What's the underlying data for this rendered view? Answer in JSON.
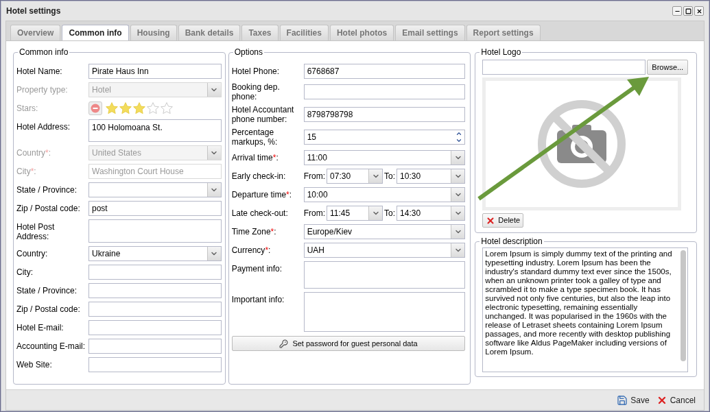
{
  "window": {
    "title": "Hotel settings"
  },
  "tabs": [
    {
      "label": "Overview",
      "selected": false
    },
    {
      "label": "Common info",
      "selected": true
    },
    {
      "label": "Housing",
      "selected": false
    },
    {
      "label": "Bank details",
      "selected": false
    },
    {
      "label": "Taxes",
      "selected": false
    },
    {
      "label": "Facilities",
      "selected": false
    },
    {
      "label": "Hotel photos",
      "selected": false
    },
    {
      "label": "Email settings",
      "selected": false
    },
    {
      "label": "Report settings",
      "selected": false
    }
  ],
  "common_info": {
    "legend": "Common info",
    "fields": [
      {
        "kind": "text",
        "label": "Hotel Name:",
        "value": "Pirate Haus Inn",
        "disabled": false
      },
      {
        "kind": "select",
        "label": "Property type:",
        "value": "Hotel",
        "disabled": true
      },
      {
        "kind": "stars",
        "label": "Stars:",
        "stars": 3,
        "disabled": true
      },
      {
        "kind": "textarea",
        "label": "Hotel Address:",
        "value": "100 Holomoana St.",
        "disabled": false
      },
      {
        "kind": "select",
        "label": "Country",
        "required_mark": "*",
        "label_end": ":",
        "value": "United States",
        "disabled": true
      },
      {
        "kind": "text",
        "label": "City",
        "required_mark": "*",
        "label_end": ":",
        "value": "Washington Court House",
        "disabled": true
      },
      {
        "kind": "select",
        "label": "State / Province:",
        "disabled": false
      },
      {
        "kind": "text",
        "label": "Zip / Postal code:",
        "value": "post",
        "disabled": false
      },
      {
        "kind": "textarea",
        "label": "Hotel Post Address:",
        "disabled": false
      },
      {
        "kind": "select",
        "label": "Country:",
        "value": "Ukraine",
        "disabled": false
      },
      {
        "kind": "text",
        "label": "City:",
        "disabled": false
      },
      {
        "kind": "text",
        "label": "State / Province:",
        "disabled": false
      },
      {
        "kind": "text",
        "label": "Zip / Postal code:",
        "disabled": false
      },
      {
        "kind": "text",
        "label": "Hotel E-mail:",
        "disabled": false
      },
      {
        "kind": "text",
        "label": "Accounting E-mail:",
        "disabled": false
      },
      {
        "kind": "text",
        "label": "Web Site:",
        "disabled": false
      }
    ]
  },
  "options": {
    "legend": "Options",
    "fields": [
      {
        "kind": "text",
        "label": "Hotel Phone:",
        "value": "6768687",
        "disabled": false
      },
      {
        "kind": "text",
        "label": "Booking dep. phone:",
        "disabled": false
      },
      {
        "kind": "text",
        "label": "Hotel Accountant phone number:",
        "value": "8798798798",
        "disabled": false
      },
      {
        "kind": "spinner",
        "label": "Percentage markups, %:",
        "value": "15",
        "disabled": false
      },
      {
        "kind": "select",
        "label": "Arrival time",
        "required_mark": "*",
        "label_end": ":",
        "value": "11:00",
        "disabled": false
      },
      {
        "kind": "range",
        "label": "Early check-in:",
        "from_label": "From:",
        "from": "07:30",
        "to_label": "To:",
        "to": "10:30",
        "disabled": false
      },
      {
        "kind": "select",
        "label": "Departure time",
        "required_mark": "*",
        "label_end": ":",
        "value": "10:00",
        "disabled": false
      },
      {
        "kind": "range",
        "label": "Late check-out:",
        "from_label": "From:",
        "from": "11:45",
        "to_label": "To:",
        "to": "14:30",
        "disabled": false
      },
      {
        "kind": "select",
        "label": "Time Zone",
        "required_mark": "*",
        "label_end": ":",
        "value": "Europe/Kiev",
        "disabled": false
      },
      {
        "kind": "select",
        "label": "Currency",
        "required_mark": "*",
        "label_end": ":",
        "value": "UAH",
        "disabled": false
      },
      {
        "kind": "textarea",
        "label": "Payment info:",
        "disabled": false
      },
      {
        "kind": "bigtextarea",
        "label": "Important info:",
        "disabled": false
      }
    ],
    "button": "Set password for guest personal data"
  },
  "logo": {
    "legend": "Hotel Logo",
    "browse": "Browse...",
    "delete": "Delete"
  },
  "description": {
    "legend": "Hotel description",
    "text": "Lorem Ipsum is simply dummy text of the printing and typesetting industry. Lorem Ipsum has been the industry's standard dummy text ever since the 1500s, when an unknown printer took a galley of type and scrambled it to make a type specimen book. It has survived not only five centuries, but also the leap into electronic typesetting, remaining essentially unchanged. It was popularised in the 1960s with the release of Letraset sheets containing Lorem Ipsum passages, and more recently with desktop publishing software like Aldus PageMaker including versions of Lorem Ipsum."
  },
  "footer": {
    "save": "Save",
    "cancel": "Cancel"
  }
}
